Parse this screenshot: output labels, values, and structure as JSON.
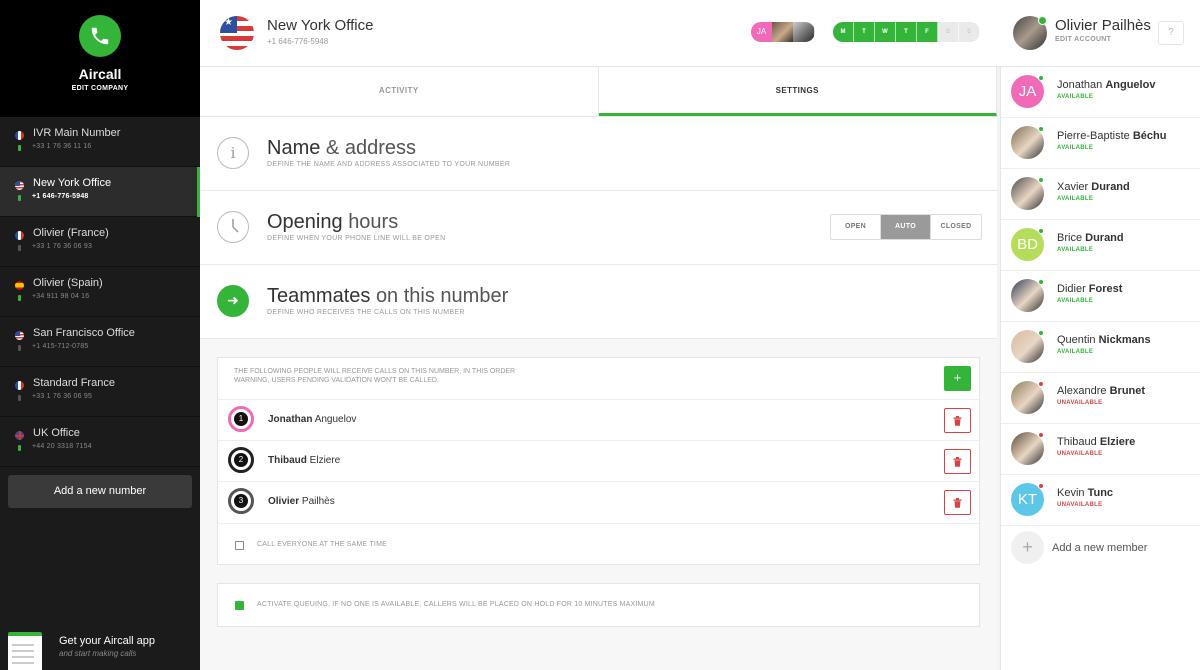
{
  "brand": {
    "name": "Aircall",
    "sub": "EDIT COMPANY"
  },
  "numbers": [
    {
      "name": "IVR Main Number",
      "phone": "+33 1 76 36 11 16",
      "flag": "fr"
    },
    {
      "name": "New York Office",
      "phone": "+1 646-776-5948",
      "flag": "us"
    },
    {
      "name": "Olivier (France)",
      "phone": "+33 1 76 36 06 93",
      "flag": "fr"
    },
    {
      "name": "Olivier (Spain)",
      "phone": "+34 911 98 04 16",
      "flag": "es"
    },
    {
      "name": "San Francisco Office",
      "phone": "+1 415-712-0785",
      "flag": "us"
    },
    {
      "name": "Standard France",
      "phone": "+33 1 76 36 06 95",
      "flag": "fr"
    },
    {
      "name": "UK Office",
      "phone": "+44 20 3318 7154",
      "flag": "uk"
    }
  ],
  "add_number_label": "Add a new number",
  "app_promo": {
    "title": "Get your Aircall app",
    "subtitle": "and start making calls"
  },
  "header": {
    "title": "New York Office",
    "phone": "+1 646-776-5948",
    "avatar_initials": "JA",
    "days": [
      "M",
      "T",
      "W",
      "T",
      "F",
      "S",
      "S"
    ],
    "days_active": 5,
    "user_first": "Olivier",
    "user_last": "Pailhès",
    "edit_account": "EDIT ACCOUNT",
    "help": "?"
  },
  "tabs": {
    "activity": "ACTIVITY",
    "settings": "SETTINGS"
  },
  "sections": {
    "name": {
      "title_bold": "Name",
      "title_rest": "& address",
      "desc": "DEFINE THE NAME AND ADDRESS ASSOCIATED TO YOUR NUMBER"
    },
    "hours": {
      "title_bold": "Opening",
      "title_rest": "hours",
      "desc": "DEFINE WHEN YOUR PHONE LINE WILL BE OPEN",
      "options": [
        "OPEN",
        "AUTO",
        "CLOSED"
      ],
      "selected": "AUTO"
    },
    "team": {
      "title_bold": "Teammates",
      "title_rest": "on this number",
      "desc": "DEFINE WHO RECEIVES THE CALLS ON THIS NUMBER"
    }
  },
  "team_box": {
    "info_1": "THE FOLLOWING PEOPLE WILL RECEIVE CALLS ON THIS NUMBER, IN THIS ORDER",
    "info_2": "WARNING, USERS PENDING VALIDATION WON'T BE CALLED.",
    "add": "+",
    "members": [
      {
        "rank": "1",
        "first": "Jonathan",
        "last": "Anguelov",
        "ring": "#f06ab8"
      },
      {
        "rank": "2",
        "first": "Thibaud",
        "last": "Elziere",
        "ring": "#222222"
      },
      {
        "rank": "3",
        "first": "Olivier",
        "last": "Pailhès",
        "ring": "#555555"
      }
    ],
    "call_all": "CALL EVERYONE AT THE SAME TIME"
  },
  "queue": {
    "label": "ACTIVATE QUEUING. IF NO ONE IS AVAILABLE, CALLERS WILL BE PLACED ON HOLD FOR 10 MINUTES MAXIMUM",
    "checked": true
  },
  "teammates": [
    {
      "first": "Jonathan",
      "last": "Anguelov",
      "status": "AVAILABLE",
      "initials": "JA",
      "color": "#f06ab8",
      "available": true
    },
    {
      "first": "Pierre-Baptiste",
      "last": "Béchu",
      "status": "AVAILABLE",
      "initials": "",
      "color": "#7a6a55",
      "available": true
    },
    {
      "first": "Xavier",
      "last": "Durand",
      "status": "AVAILABLE",
      "initials": "",
      "color": "#4a4a4a",
      "available": true
    },
    {
      "first": "Brice",
      "last": "Durand",
      "status": "AVAILABLE",
      "initials": "BD",
      "color": "#b5dd5a",
      "available": true
    },
    {
      "first": "Didier",
      "last": "Forest",
      "status": "AVAILABLE",
      "initials": "",
      "color": "#2d3a55",
      "available": true
    },
    {
      "first": "Quentin",
      "last": "Nickmans",
      "status": "AVAILABLE",
      "initials": "",
      "color": "#d9b8a2",
      "available": true
    },
    {
      "first": "Alexandre",
      "last": "Brunet",
      "status": "UNAVAILABLE",
      "initials": "",
      "color": "#8c7a5a",
      "available": false
    },
    {
      "first": "Thibaud",
      "last": "Elziere",
      "status": "UNAVAILABLE",
      "initials": "",
      "color": "#5a4a3a",
      "available": false
    },
    {
      "first": "Kevin",
      "last": "Tunc",
      "status": "UNAVAILABLE",
      "initials": "KT",
      "color": "#5cc7e6",
      "available": false
    }
  ],
  "add_member": {
    "plus": "+",
    "label": "Add a new member"
  },
  "colors": {
    "accent": "#34b53a",
    "danger": "#d64545",
    "sidebar": "#1b1b1b"
  }
}
